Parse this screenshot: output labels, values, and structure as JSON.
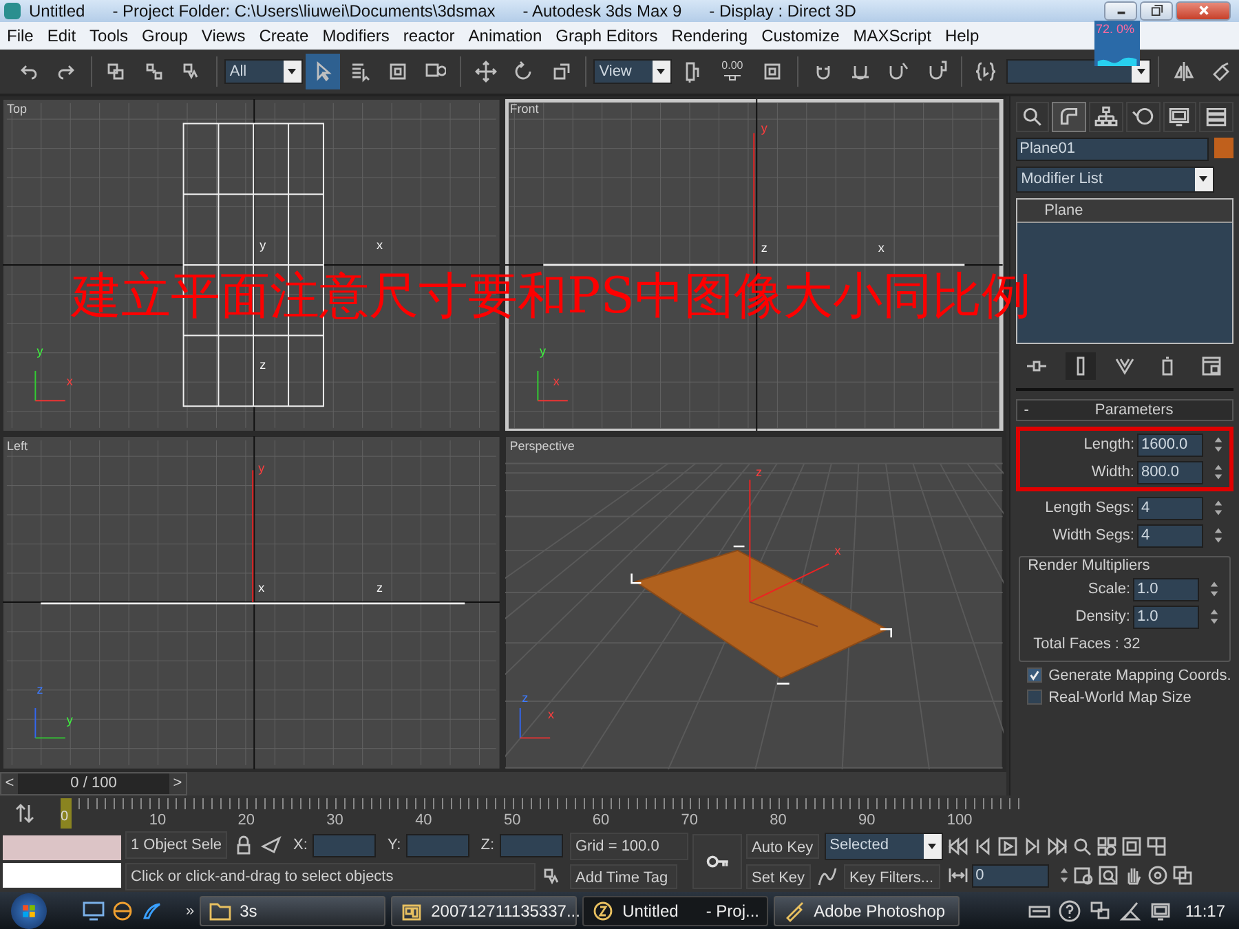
{
  "window": {
    "title": "Untitled      - Project Folder: C:\\Users\\liuwei\\Documents\\3dsmax      - Autodesk 3ds Max 9      - Display : Direct 3D"
  },
  "menu": [
    "File",
    "Edit",
    "Tools",
    "Group",
    "Views",
    "Create",
    "Modifiers",
    "reactor",
    "Animation",
    "Graph Editors",
    "Rendering",
    "Customize",
    "MAXScript",
    "Help"
  ],
  "toolbar": [
    {
      "kind": "button",
      "selected": false
    },
    {
      "kind": "button",
      "selected": false
    },
    {
      "kind": "button",
      "selected": false
    },
    {
      "kind": "button",
      "selected": false
    },
    {
      "kind": "button",
      "selected": false
    },
    {
      "kind": "dropdown",
      "value": "All"
    },
    {
      "kind": "button",
      "selected": true
    },
    {
      "kind": "button",
      "selected": false
    },
    {
      "kind": "button",
      "selected": false
    },
    {
      "kind": "button",
      "selected": false
    },
    {
      "kind": "button",
      "selected": false
    },
    {
      "kind": "button",
      "selected": false
    },
    {
      "kind": "button",
      "selected": false
    },
    {
      "kind": "dropdown",
      "value": "View"
    },
    {
      "kind": "button",
      "selected": false
    },
    {
      "kind": "snap",
      "label": "0.00"
    },
    {
      "kind": "button",
      "selected": false
    },
    {
      "kind": "button",
      "selected": false
    },
    {
      "kind": "button",
      "selected": false
    },
    {
      "kind": "button",
      "selected": false
    },
    {
      "kind": "button",
      "selected": false
    },
    {
      "kind": "button",
      "selected": false
    },
    {
      "kind": "field"
    },
    {
      "kind": "button",
      "selected": false
    },
    {
      "kind": "button",
      "selected": false
    }
  ],
  "meter": {
    "reading": "72. 0%"
  },
  "viewports": [
    {
      "kind": "top",
      "label": "Top",
      "selected": false,
      "axis_labels": [
        "y",
        "x",
        "z"
      ],
      "tripod_labels": [
        "y",
        "x"
      ]
    },
    {
      "kind": "front",
      "label": "Front",
      "selected": true,
      "axis_labels": [
        "y",
        "z",
        "x"
      ],
      "tripod_labels": [
        "y",
        "x"
      ]
    },
    {
      "kind": "left",
      "label": "Left",
      "selected": false,
      "axis_labels": [
        "y",
        "x",
        "z"
      ],
      "tripod_labels": [
        "z",
        "y"
      ]
    },
    {
      "kind": "perspective",
      "label": "Perspective",
      "selected": false,
      "axis_labels": [
        "z",
        "x"
      ],
      "tripod_labels": [
        "z",
        "x"
      ]
    }
  ],
  "annotation": "建立平面注意尺寸要和PS中图像大小同比例",
  "command_panel": {
    "tabs": [
      {
        "selected": false
      },
      {
        "selected": true
      },
      {
        "selected": false
      },
      {
        "selected": false
      },
      {
        "selected": false
      },
      {
        "selected": false
      }
    ],
    "object_name": "Plane01",
    "modifier_list": "Modifier List",
    "stack": [
      "Plane"
    ],
    "rollout": {
      "title": "Parameters",
      "toggle": "-",
      "highlighted_fields": [
        {
          "label": "Length:",
          "value": "1600.0"
        },
        {
          "label": "Width:",
          "value": "800.0"
        }
      ],
      "fields": [
        {
          "label": "Length Segs:",
          "value": "4"
        },
        {
          "label": "Width Segs:",
          "value": "4"
        }
      ],
      "group": {
        "title": "Render Multipliers",
        "fields": [
          {
            "label": "Scale:",
            "value": "1.0"
          },
          {
            "label": "Density:",
            "value": "1.0"
          }
        ],
        "total": "Total Faces : 32"
      },
      "checkboxes": [
        {
          "label": "Generate Mapping Coords.",
          "checked": true
        },
        {
          "label": "Real-World Map Size",
          "checked": false
        }
      ]
    }
  },
  "time_slider": {
    "prev": "<",
    "position": "0 / 100",
    "next": ">"
  },
  "ruler": [
    "0",
    "10",
    "20",
    "30",
    "40",
    "50",
    "60",
    "70",
    "80",
    "90",
    "100"
  ],
  "status": {
    "selection": "1 Object Sele",
    "x_label": "X:",
    "y_label": "Y:",
    "z_label": "Z:",
    "grid": "Grid = 100.0",
    "prompt": "Click or click-and-drag to select objects",
    "time_tag": "Add Time Tag",
    "auto_key": "Auto Key",
    "set_key": "Set Key",
    "key_mode": "Selected",
    "key_filters": "Key Filters...",
    "frame": "0"
  },
  "taskbar": {
    "quick_launch_more": "»",
    "tasks": [
      {
        "label": "3s",
        "selected": false
      },
      {
        "label": "200712711135337...",
        "selected": false
      },
      {
        "label": "Untitled      - Proj...",
        "selected": true
      },
      {
        "label": "Adobe Photoshop",
        "selected": false
      }
    ],
    "clock": "11:17"
  }
}
